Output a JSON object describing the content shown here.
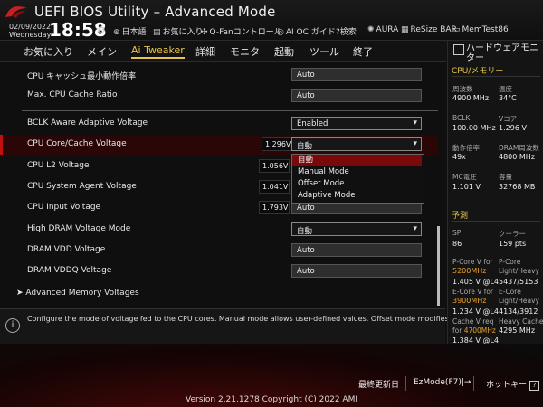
{
  "header": {
    "title": "UEFI BIOS Utility – Advanced Mode",
    "date_line1": "02/09/2022",
    "date_line2": "Wednesday",
    "time": "18:58",
    "tools": [
      {
        "label": "日本語",
        "icon": "globe-icon"
      },
      {
        "label": "お気に入り",
        "icon": "favorites-icon"
      },
      {
        "label": "Q-Fanコントロール",
        "icon": "fan-icon"
      },
      {
        "label": "AI OC ガイド",
        "icon": "ai-guide-icon"
      },
      {
        "label": "?検索",
        "icon": "search-icon"
      },
      {
        "label": "AURA",
        "icon": "aura-icon"
      },
      {
        "label": "ReSize BAR",
        "icon": "resize-bar-icon"
      },
      {
        "label": "MemTest86",
        "icon": "memtest-icon"
      }
    ]
  },
  "menu": {
    "items": [
      "お気に入り",
      "メイン",
      "Ai Tweaker",
      "詳細",
      "モニタ",
      "起動",
      "ツール",
      "終了"
    ],
    "active": "Ai Tweaker"
  },
  "settings": [
    {
      "label": "CPU キャッシュ最小動作倍率",
      "value": "Auto",
      "type": "input"
    },
    {
      "label": "Max. CPU Cache Ratio",
      "value": "Auto",
      "type": "input"
    },
    {
      "label": "BCLK Aware Adaptive Voltage",
      "value": "Enabled",
      "type": "dropdown"
    },
    {
      "label": "CPU Core/Cache Voltage",
      "voltage": "1.296V",
      "value": "自動",
      "type": "dropdown",
      "selected": true
    },
    {
      "label": "CPU L2 Voltage",
      "voltage": "1.056V",
      "value": "",
      "type": "input"
    },
    {
      "label": "CPU System Agent Voltage",
      "voltage": "1.041V",
      "value": "",
      "type": "input"
    },
    {
      "label": "CPU Input Voltage",
      "voltage": "1.793V",
      "value": "Auto",
      "type": "input"
    },
    {
      "label": "High DRAM Voltage Mode",
      "value": "自動",
      "type": "dropdown"
    },
    {
      "label": "DRAM VDD Voltage",
      "value": "Auto",
      "type": "input"
    },
    {
      "label": "DRAM VDDQ Voltage",
      "value": "Auto",
      "type": "input"
    }
  ],
  "expander": "Advanced Memory Voltages",
  "dropdown_options": [
    "自動",
    "Manual Mode",
    "Offset Mode",
    "Adaptive Mode"
  ],
  "dropdown_highlighted": "自動",
  "help_text": "Configure the mode of voltage fed to the CPU cores. Manual mode allows user-defined values. Offset mode modifies values by SVID.",
  "footer": {
    "last_modified": "最終更新日",
    "ezmode": "EzMode(F7)|→",
    "hotkeys": "ホットキー",
    "hotkeys_icon": "?",
    "version": "Version 2.21.1278 Copyright (C) 2022 AMI"
  },
  "hw_monitor": {
    "title": "ハードウェアモニター",
    "cpu_mem_section": "CPU/メモリー",
    "rows": [
      {
        "k1": "周波数",
        "v1": "4900 MHz",
        "k2": "温度",
        "v2": "34°C"
      },
      {
        "k1": "BCLK",
        "v1": "100.00 MHz",
        "k2": "Vコア",
        "v2": "1.296 V"
      },
      {
        "k1": "動作倍率",
        "v1": "49x",
        "k2": "DRAM周波数",
        "v2": "4800 MHz"
      },
      {
        "k1": "MC電圧",
        "v1": "1.101 V",
        "k2": "容量",
        "v2": "32768 MB"
      }
    ],
    "predict_section": "予測",
    "sp_label": "SP",
    "sp_value": "86",
    "cooler_label": "クーラー",
    "cooler_value": "159 pts",
    "pcore_label": "P-Core V for",
    "pcore_freq": "5200MHz",
    "pcore_light_label": "P-Core",
    "pcore_light_sub": "Light/Heavy",
    "pcore_v": "1.405 V @L4",
    "pcore_lh": "5437/5153",
    "ecore_label": "E-Core V for",
    "ecore_freq": "3900MHz",
    "ecore_light_label": "E-Core",
    "ecore_light_sub": "Light/Heavy",
    "ecore_v": "1.234 V @L4",
    "ecore_lh": "4134/3912",
    "cache_label": "Cache V req",
    "cache_for": "for",
    "cache_freq": "4700MHz",
    "heavy_cache_label": "Heavy Cache",
    "heavy_cache_value": "4295 MHz",
    "cache_v": "1.384 V @L4"
  }
}
